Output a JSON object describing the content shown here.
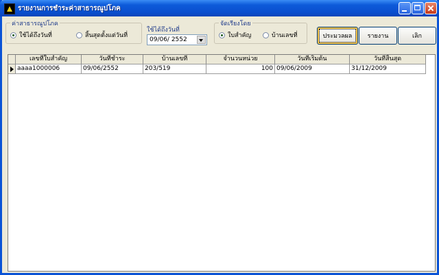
{
  "window": {
    "title": "รายงานการชำระค่าสาธารณูปโภค"
  },
  "filter_group": {
    "legend": "ค่าสาธารณูปโภค",
    "options": [
      {
        "label": "ใช้ได้ถึงวันที่",
        "selected": true
      },
      {
        "label": "สิ้นสุดตั้งแต่วันที่",
        "selected": false
      }
    ]
  },
  "date": {
    "label": "ใช้ได้ถึงวันที่",
    "value": "09/06/ 2552"
  },
  "sort_group": {
    "legend": "จัดเรียงโดย",
    "options": [
      {
        "label": "ใบสำคัญ",
        "selected": true
      },
      {
        "label": "บ้านเลขที่",
        "selected": false
      }
    ]
  },
  "buttons": {
    "process": "ประมวลผล",
    "report": "รายงาน",
    "cancel": "เลิก"
  },
  "table": {
    "columns": [
      "เลขที่ใบสำคัญ",
      "วันที่ชำระ",
      "บ้านเลขที่",
      "จำนวนหน่วย",
      "วันที่เริ่มต้น",
      "วันที่สิ้นสุด"
    ],
    "rows": [
      [
        "aaaa1000006",
        "09/06/2552",
        "203/519",
        "100",
        "09/06/2009",
        "31/12/2009"
      ]
    ]
  },
  "colors": {
    "titlebar": "#0a4fcf",
    "window_bg": "#ece9d8",
    "legend_text": "#1f3b8a"
  }
}
